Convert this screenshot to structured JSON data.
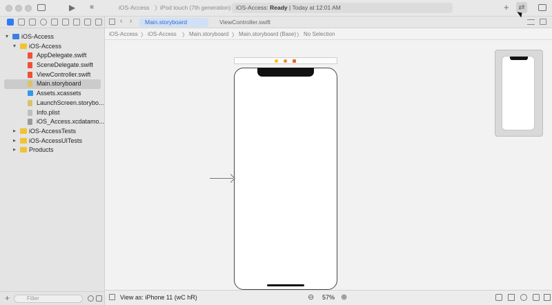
{
  "toolbar": {
    "run_glyph": "▶",
    "stop_glyph": "■",
    "scheme": "iOS-Access",
    "device": "iPod touch (7th generation)",
    "activity_project": "iOS-Access:",
    "activity_status": "Ready",
    "activity_time": "Today at 12:01 AM",
    "add_glyph": "+",
    "swap_glyph": "⇄"
  },
  "navigator": {
    "items": [
      {
        "label": "iOS-Access",
        "type": "proj",
        "level": 0,
        "disclosure": "▾"
      },
      {
        "label": "iOS-Access",
        "type": "folder",
        "level": 1,
        "disclosure": "▾"
      },
      {
        "label": "AppDelegate.swift",
        "type": "swift",
        "level": 2
      },
      {
        "label": "SceneDelegate.swift",
        "type": "swift",
        "level": 2
      },
      {
        "label": "ViewController.swift",
        "type": "swift",
        "level": 2
      },
      {
        "label": "Main.storyboard",
        "type": "sb",
        "level": 2,
        "selected": true
      },
      {
        "label": "Assets.xcassets",
        "type": "assets",
        "level": 2
      },
      {
        "label": "LaunchScreen.storybo...",
        "type": "sb",
        "level": 2
      },
      {
        "label": "Info.plist",
        "type": "plist",
        "level": 2
      },
      {
        "label": "iOS_Access.xcdatamo...",
        "type": "xcdm",
        "level": 2
      },
      {
        "label": "iOS-AccessTests",
        "type": "folder",
        "level": 1,
        "disclosure": "▸"
      },
      {
        "label": "iOS-AccessUITests",
        "type": "folder",
        "level": 1,
        "disclosure": "▸"
      },
      {
        "label": "Products",
        "type": "folder",
        "level": 1,
        "disclosure": "▸"
      }
    ],
    "add_glyph": "+",
    "filter_placeholder": "Filter"
  },
  "tabs": {
    "active": "Main.storyboard",
    "inactive": "ViewController.swift"
  },
  "jumpbar": {
    "crumbs": [
      "iOS-Access",
      "iOS-Access",
      "Main.storyboard",
      "Main.storyboard (Base)",
      "No Selection"
    ],
    "separator": "〉"
  },
  "bottom": {
    "view_as": "View as: iPhone 11 (wC hR)",
    "zoom_out_glyph": "⊖",
    "zoom_in_glyph": "⊕",
    "zoom": "57%"
  },
  "colors": {
    "accent": "#2f7bf5",
    "scene_dot_1": "#f5c400",
    "scene_dot_2": "#f08a24",
    "scene_dot_3": "#e06a2a"
  }
}
